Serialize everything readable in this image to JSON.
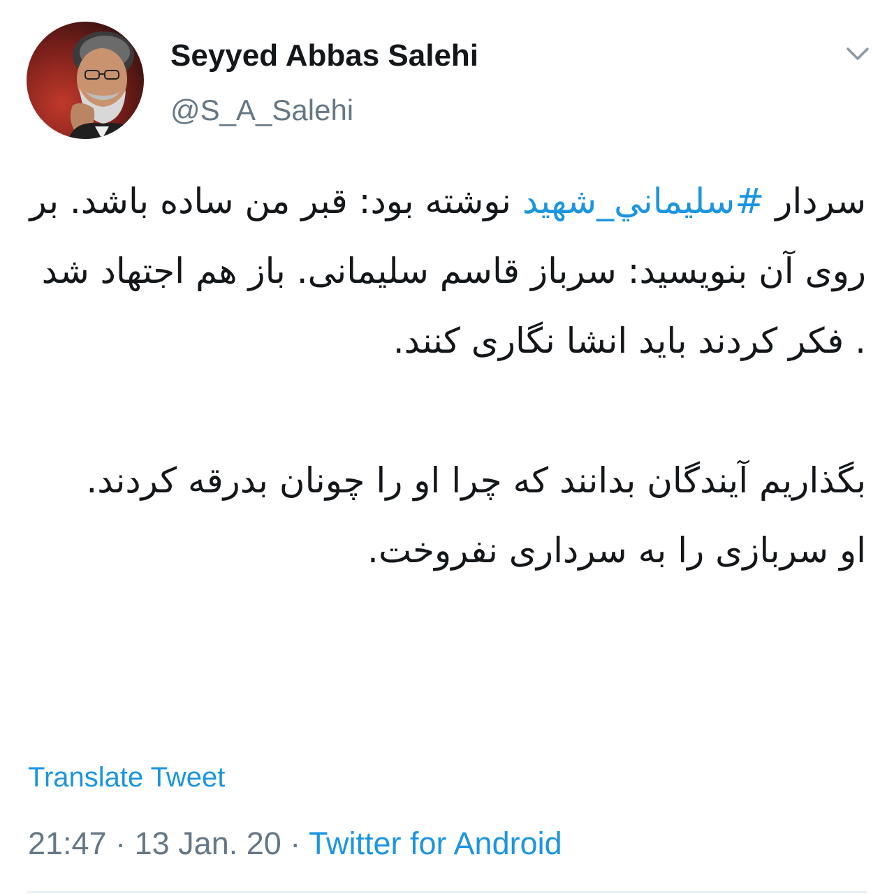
{
  "author": {
    "display_name": "Seyyed Abbas Salehi",
    "handle": "@S_A_Salehi"
  },
  "tweet": {
    "line1_start": "سردار ",
    "hashtag": "#سليماني_شهيد",
    "line1_end": " نوشته بود: قبر من ساده باشد. بر روی آن بنویسید: سرباز قاسم سلیمانی. باز هم اجتهاد شد . فکر کردند باید انشا نگاری کنند.",
    "paragraph2": "بگذاریم آیندگان بدانند که چرا او را چونان بدرقه کردند.",
    "paragraph3": "او سربازی را به سرداری نفروخت."
  },
  "translate_label": "Translate Tweet",
  "meta": {
    "time": "21:47",
    "separator": " · ",
    "date": "13 Jan. 20",
    "source": "Twitter for Android"
  },
  "icons": {
    "avatar": "profile-photo",
    "menu": "chevron-down-icon"
  },
  "colors": {
    "link": "#1b95e0",
    "secondary_text": "#657786",
    "primary_text": "#14171a"
  }
}
